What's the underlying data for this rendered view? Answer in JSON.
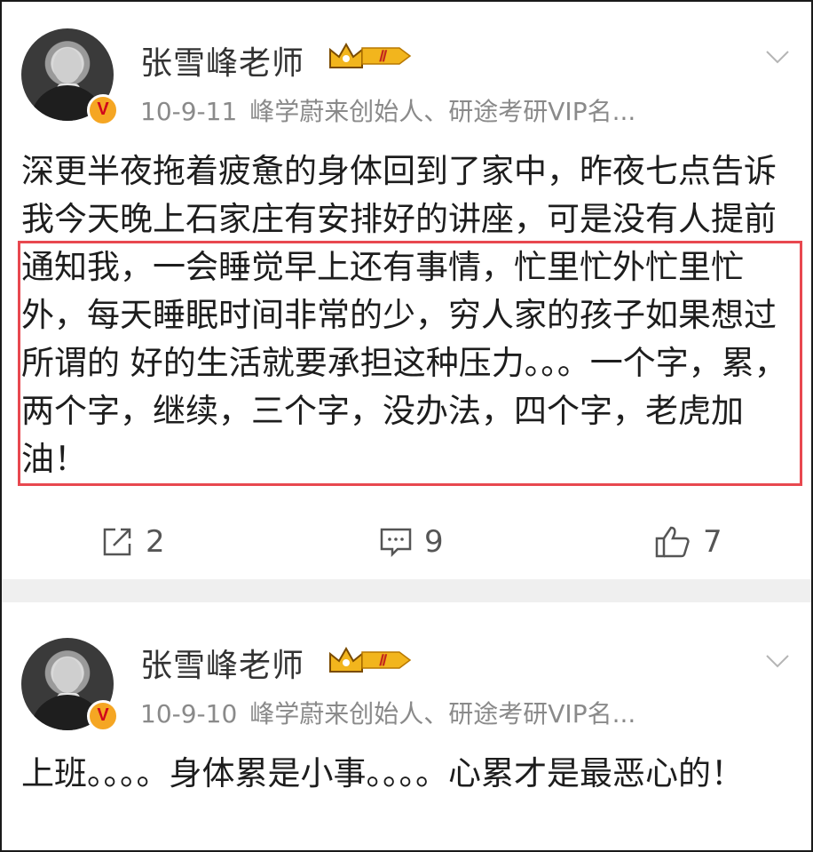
{
  "posts": [
    {
      "author": "张雪峰老师",
      "level": "Ⅱ",
      "verified_badge": "V",
      "date": "10-9-11",
      "bio": "峰学蔚来创始人、研途考研VIP名...",
      "content": "深更半夜拖着疲惫的身体回到了家中，昨夜七点告诉我今天晚上石家庄有安排好的讲座，可是没有人提前通知我，一会睡觉早上还有事情，忙里忙外忙里忙外，每天睡眠时间非常的少，穷人家的孩子如果想过所谓的 好的生活就要承担这种压力。。。一个字，累，两个字，继续，三个字，没办法，四个字，老虎加油！",
      "reposts": "2",
      "comments": "9",
      "likes": "7"
    },
    {
      "author": "张雪峰老师",
      "level": "Ⅱ",
      "verified_badge": "V",
      "date": "10-9-10",
      "bio": "峰学蔚来创始人、研途考研VIP名...",
      "content": "上班。。。。身体累是小事。。。。心累才是最恶心的！"
    }
  ],
  "icons": {
    "repost": "share-icon",
    "comment": "comment-icon",
    "like": "thumbs-up-icon",
    "more": "chevron-down-icon",
    "crown": "crown-level-icon"
  },
  "colors": {
    "highlight_border": "#e8484f",
    "verified_badge": "#f5a623",
    "crown_gold": "#f2b51d",
    "meta_gray": "#8a8a8a"
  }
}
